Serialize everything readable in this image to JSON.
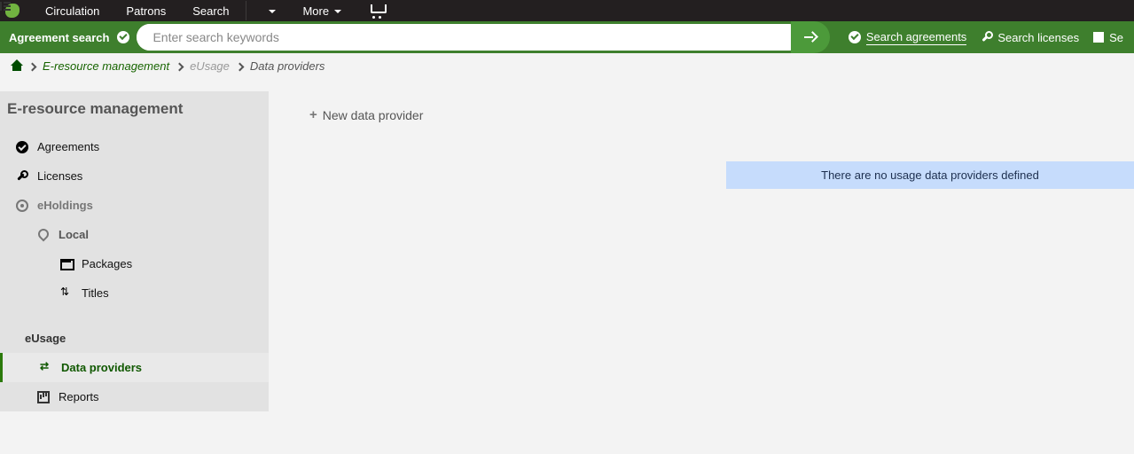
{
  "topnav": {
    "items": [
      "Circulation",
      "Patrons",
      "Search"
    ],
    "more": "More"
  },
  "searchbar": {
    "label": "Agreement search",
    "placeholder": "Enter search keywords",
    "links": [
      {
        "label": "Search agreements",
        "icon": "check",
        "active": true
      },
      {
        "label": "Search licenses",
        "icon": "wrench",
        "active": false
      },
      {
        "label": "Se",
        "icon": "box",
        "active": false
      }
    ]
  },
  "breadcrumb": {
    "link": "E-resource management",
    "mute": "eUsage",
    "last": "Data providers"
  },
  "sidebar": {
    "title": "E-resource management",
    "agreements": "Agreements",
    "licenses": "Licenses",
    "eholdings": "eHoldings",
    "local": "Local",
    "packages": "Packages",
    "titles": "Titles",
    "eusage": "eUsage",
    "dataproviders": "Data providers",
    "reports": "Reports"
  },
  "main": {
    "newdp": "New data provider",
    "msg": "There are no usage data providers defined"
  }
}
